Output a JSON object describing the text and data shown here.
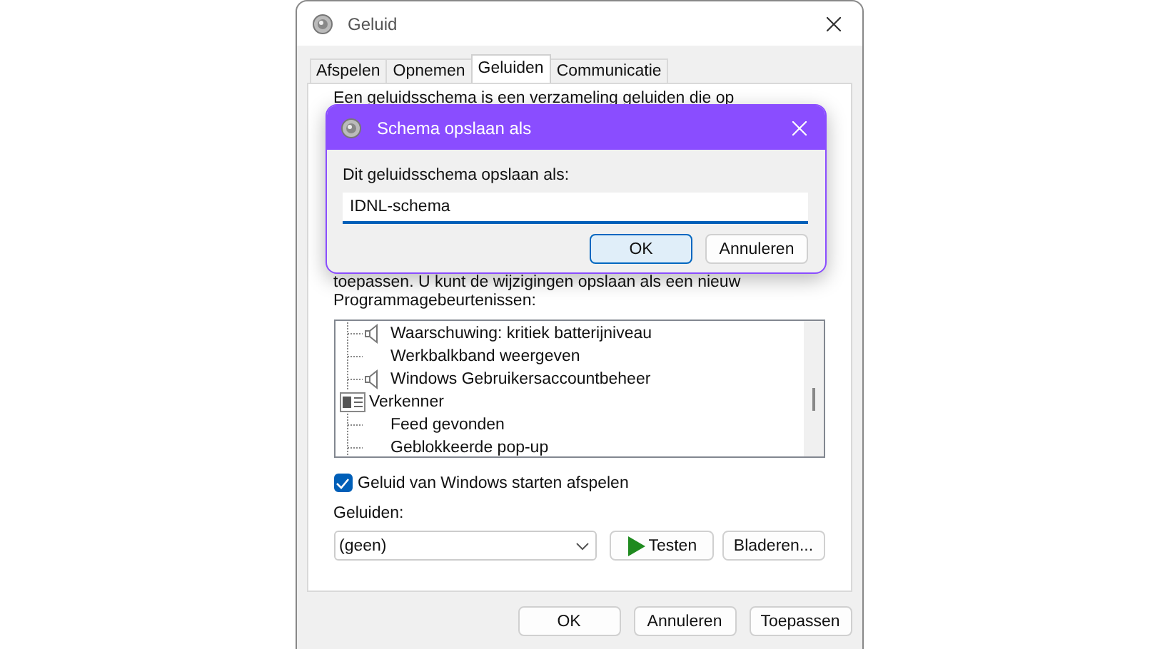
{
  "window": {
    "title": "Geluid"
  },
  "tabs": [
    {
      "label": "Afspelen",
      "selected": false
    },
    {
      "label": "Opnemen",
      "selected": false
    },
    {
      "label": "Geluiden",
      "selected": true
    },
    {
      "label": "Communicatie",
      "selected": false
    }
  ],
  "description_top": "Een geluidsschema is een verzameling geluiden die op",
  "description_bottom": "toepassen. U kunt de wijzigingen opslaan als een nieuw",
  "events_label": "Programmagebeurtenissen:",
  "events": [
    {
      "kind": "event",
      "label": "Waarschuwing: kritiek batterijniveau",
      "sound": true
    },
    {
      "kind": "event",
      "label": "Werkbalkband weergeven",
      "sound": false
    },
    {
      "kind": "event",
      "label": "Windows Gebruikersaccountbeheer",
      "sound": true
    },
    {
      "kind": "application",
      "label": "Verkenner",
      "children": [
        {
          "kind": "event",
          "label": "Feed gevonden",
          "sound": false
        },
        {
          "kind": "event",
          "label": "Geblokkeerde pop-up",
          "sound": false
        }
      ]
    }
  ],
  "startup_sound": {
    "label": "Geluid van Windows starten afspelen",
    "checked": true
  },
  "sounds_label": "Geluiden:",
  "sound_select": {
    "value": "(geen)"
  },
  "test_button": "Testen",
  "browse_button": "Bladeren...",
  "buttons": [
    "OK",
    "Annuleren",
    "Toepassen"
  ],
  "dialog": {
    "title": "Schema opslaan als",
    "prompt": "Dit geluidsschema opslaan als:",
    "value": "IDNL-schema",
    "buttons": [
      {
        "label": "OK",
        "default": true
      },
      {
        "label": "Annuleren",
        "default": false
      }
    ]
  }
}
